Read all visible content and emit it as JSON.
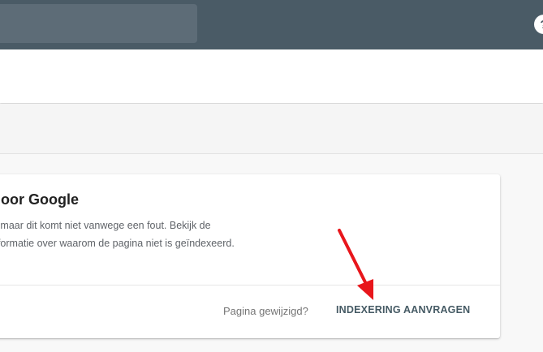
{
  "card": {
    "title": "door Google",
    "description_lines": [
      "t, maar dit komt niet vanwege een fout. Bekijk de",
      "nformatie over waarom de pagina niet is geïndexeerd."
    ],
    "changed_prompt": "Pagina gewijzigd?",
    "request_button_label": "INDEXERING AANVRAGEN"
  },
  "colors": {
    "topbar": "#4a5b66",
    "annotation_arrow": "#e8161b",
    "button_text": "#455a64"
  },
  "icons": {
    "help": "help-icon"
  }
}
